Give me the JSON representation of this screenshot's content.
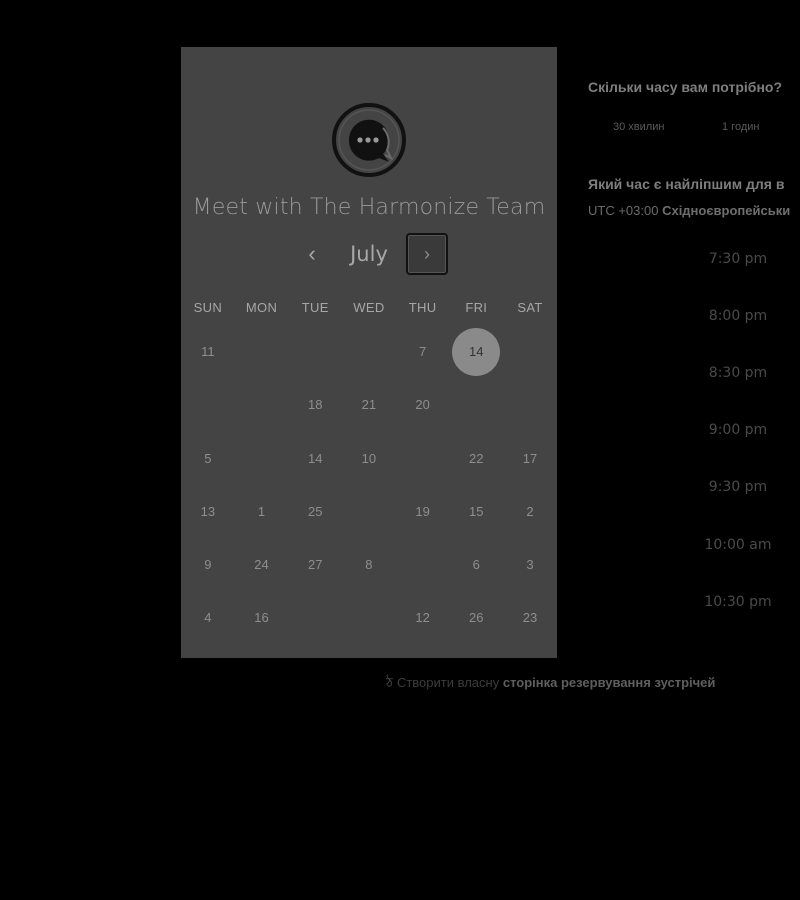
{
  "card": {
    "title": "Meet with The Harmonize Team",
    "month": "July",
    "prev_icon": "chevron-left-icon",
    "next_icon": "chevron-right-icon",
    "weekdays": [
      "SUN",
      "MON",
      "TUE",
      "WED",
      "THU",
      "FRI",
      "SAT"
    ],
    "weeks": [
      [
        "11",
        "",
        "",
        "",
        "7",
        "14",
        ""
      ],
      [
        "",
        "",
        "18",
        "21",
        "20",
        "",
        ""
      ],
      [
        "5",
        "",
        "14",
        "10",
        "",
        "22",
        "17"
      ],
      [
        "13",
        "1",
        "25",
        "",
        "19",
        "15",
        "2"
      ],
      [
        "9",
        "24",
        "27",
        "8",
        "",
        "6",
        "3"
      ],
      [
        "4",
        "16",
        "",
        "",
        "12",
        "26",
        "23"
      ]
    ],
    "selected_day": "14"
  },
  "right": {
    "duration_question": "Скільки часу вам потрібно?",
    "durations": [
      "30 хвилин",
      "1 годин"
    ],
    "time_question": "Який час є найліпшим для в",
    "timezone_offset": "UTC +03:00",
    "timezone_name": "Східноєвропейськи",
    "slots": [
      "7:30 pm",
      "8:00 pm",
      "8:30 pm",
      "9:00 pm",
      "9:30 pm",
      "10:00 am",
      "10:30 pm"
    ]
  },
  "footer": {
    "prefix": "Створити власну",
    "link": "сторінка резервування зустрічей"
  },
  "colors": {
    "background": "#000000",
    "card": "#444444",
    "selected_day": "#8a8a8a"
  }
}
